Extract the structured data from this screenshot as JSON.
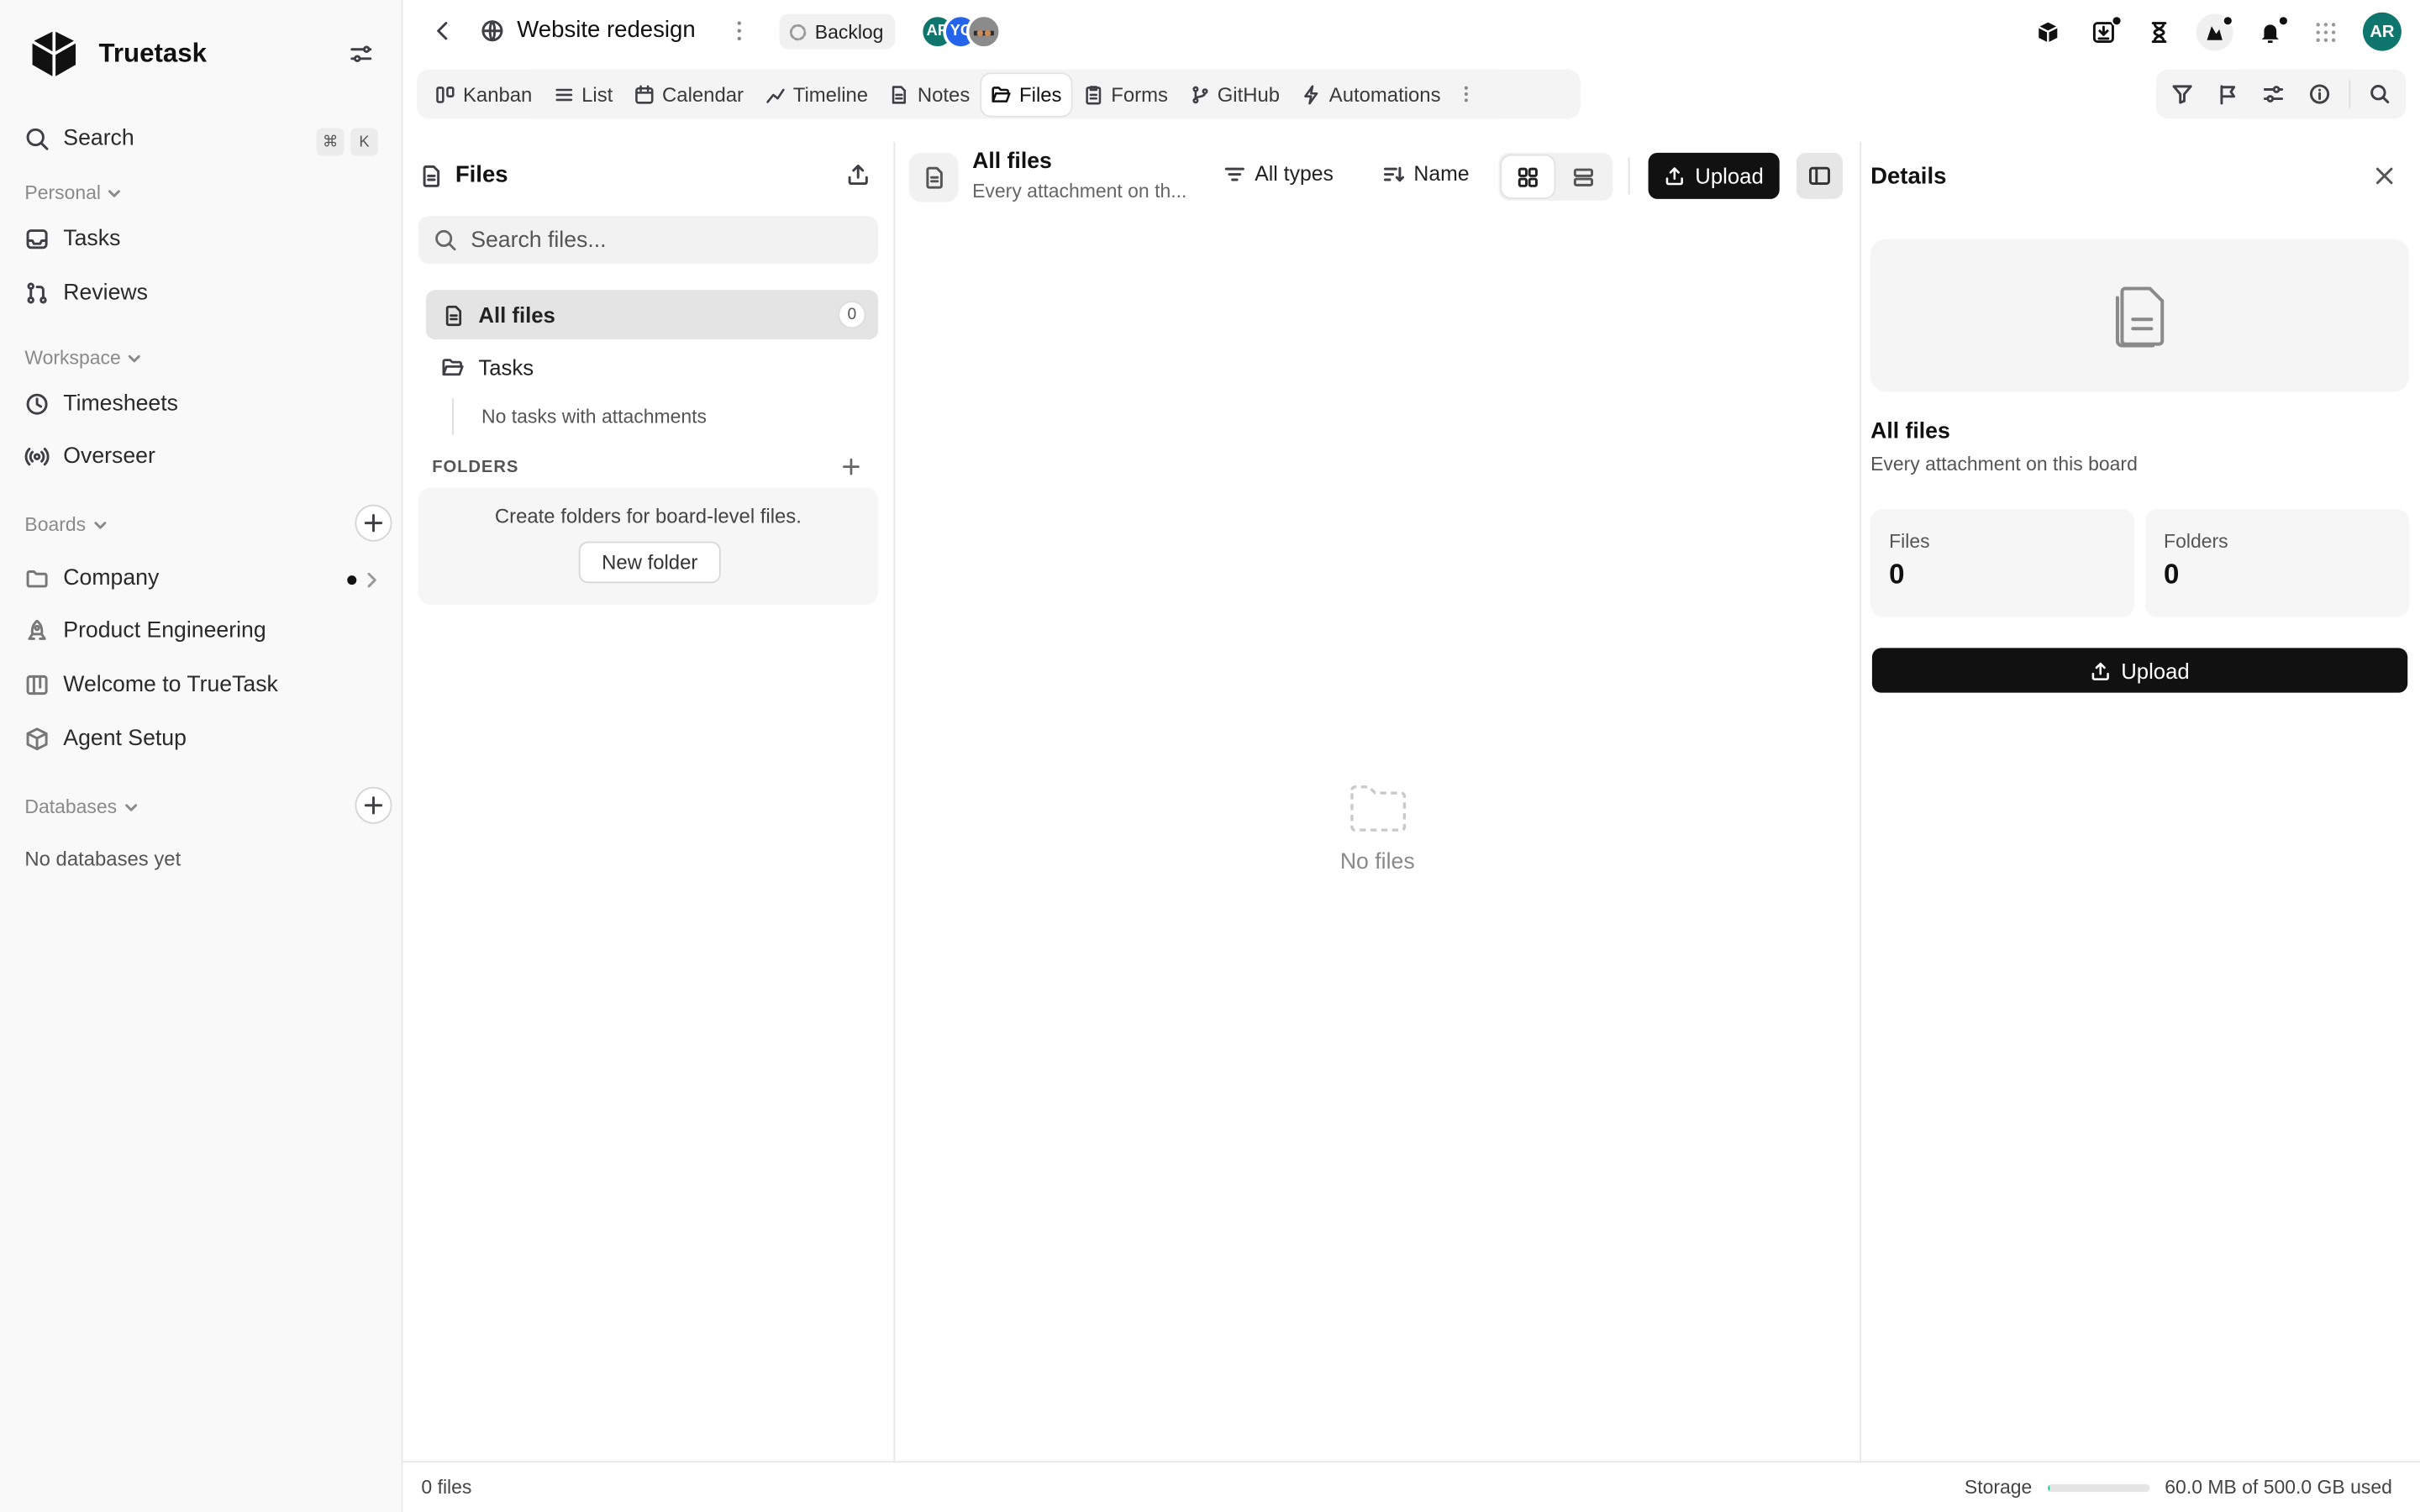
{
  "sidebar": {
    "brand": "Truetask",
    "search_label": "Search",
    "shortcut": [
      "⌘",
      "K"
    ],
    "sections": {
      "personal": "Personal",
      "workspace": "Workspace",
      "boards": "Boards",
      "databases": "Databases"
    },
    "personal_items": [
      {
        "label": "Tasks",
        "icon": "inbox-icon"
      },
      {
        "label": "Reviews",
        "icon": "git-pull-request-icon"
      }
    ],
    "workspace_items": [
      {
        "label": "Timesheets",
        "icon": "clock-icon"
      },
      {
        "label": "Overseer",
        "icon": "broadcast-icon"
      }
    ],
    "board_items": [
      {
        "label": "Company",
        "icon": "folder-icon"
      },
      {
        "label": "Product Engineering",
        "icon": "rocket-icon"
      },
      {
        "label": "Welcome to TrueTask",
        "icon": "kanban-icon"
      },
      {
        "label": "Agent Setup",
        "icon": "cube-icon"
      }
    ],
    "no_databases": "No databases yet"
  },
  "header": {
    "project_title": "Website redesign",
    "status": "Backlog",
    "avatars": [
      {
        "initials": "AR",
        "color": "#0f766e"
      },
      {
        "initials": "YC",
        "color": "#2563eb"
      },
      {
        "initials": "",
        "color": "#6b7280"
      }
    ],
    "user_initials": "AR"
  },
  "tabs": [
    "Kanban",
    "List",
    "Calendar",
    "Timeline",
    "Notes",
    "Files",
    "Forms",
    "GitHub",
    "Automations"
  ],
  "tree": {
    "title": "Files",
    "search_placeholder": "Search files...",
    "all_files_label": "All files",
    "all_files_count": "0",
    "tasks_label": "Tasks",
    "tasks_empty": "No tasks with attachments",
    "folders_label": "FOLDERS",
    "folders_hint": "Create folders for board-level files.",
    "new_folder": "New folder"
  },
  "main": {
    "title": "All files",
    "subtitle": "Every attachment on th...",
    "type_filter": "All types",
    "sort": "Name",
    "upload": "Upload",
    "empty": "No files"
  },
  "details": {
    "title": "Details",
    "name": "All files",
    "subtitle": "Every attachment on this board",
    "files_label": "Files",
    "files_value": "0",
    "folders_label": "Folders",
    "folders_value": "0",
    "upload": "Upload"
  },
  "footer": {
    "file_count": "0 files",
    "storage_label": "Storage",
    "storage_used_fraction": 0.02,
    "storage_text": "60.0 MB of 500.0 GB used"
  },
  "colors": {
    "accent": "#111111",
    "storage": "#10b981",
    "user_avatar": "#0f766e"
  }
}
